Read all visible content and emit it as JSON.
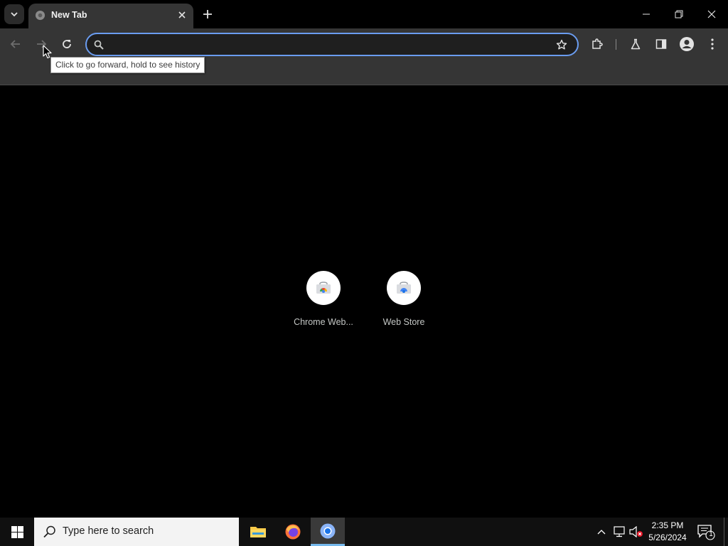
{
  "browser": {
    "tab": {
      "title": "New Tab"
    },
    "omnibox": {
      "value": "",
      "placeholder": ""
    },
    "tooltip": {
      "text": "Click to go forward, hold to see history"
    },
    "accent_color": "#6a9cf0"
  },
  "shortcuts": [
    {
      "label": "Chrome Web..."
    },
    {
      "label": "Web Store"
    }
  ],
  "taskbar": {
    "search_placeholder": "Type here to search",
    "clock": {
      "time": "2:35 PM",
      "date": "5/26/2024"
    },
    "notification_count": "1"
  }
}
